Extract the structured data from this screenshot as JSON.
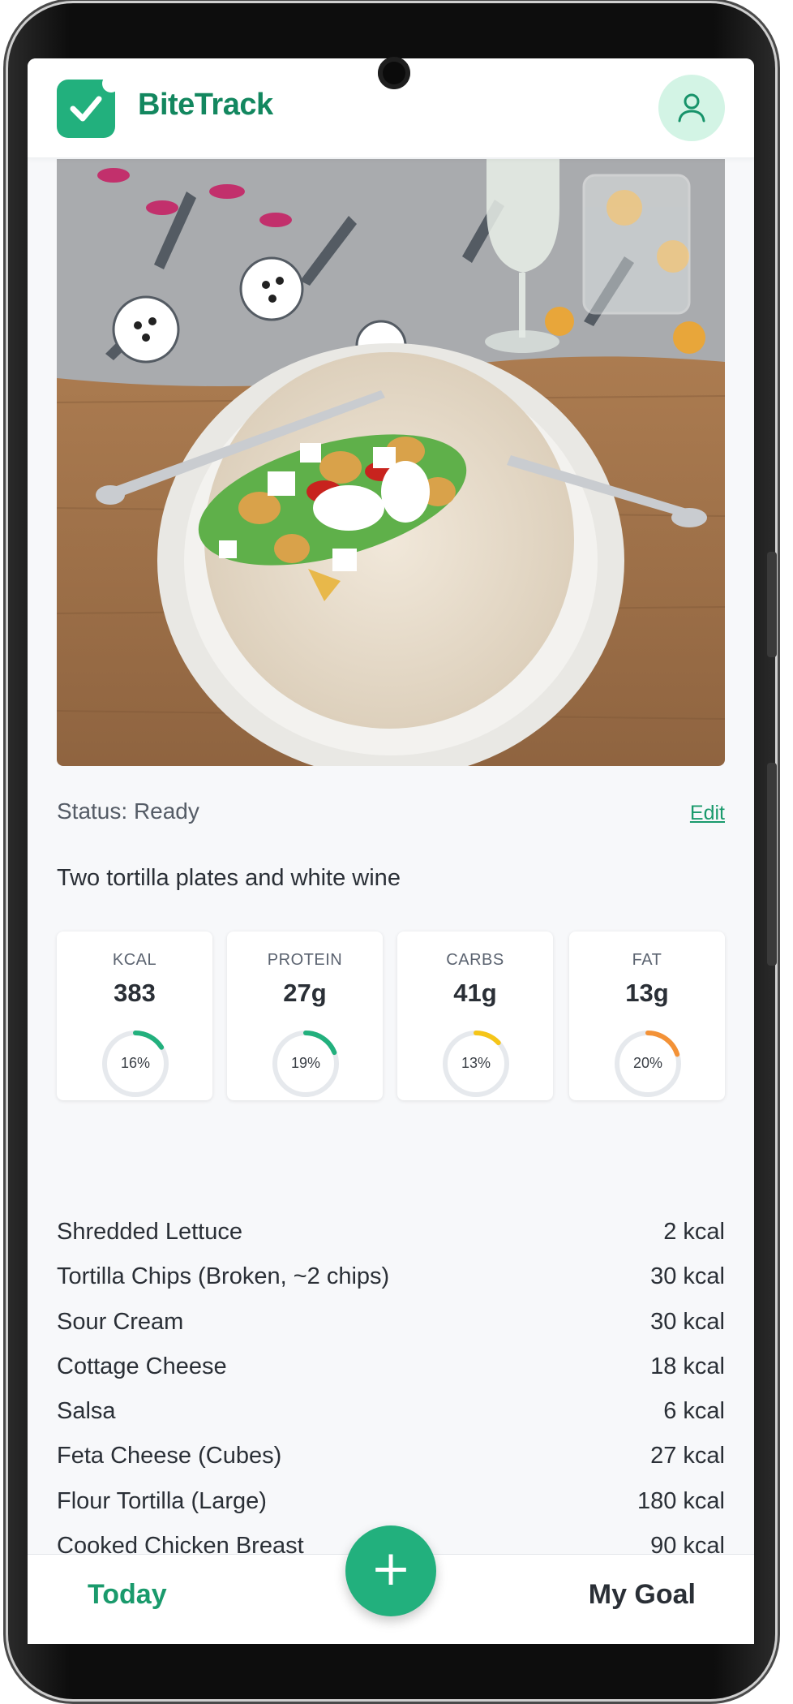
{
  "app": {
    "name": "BiteTrack",
    "brand_color": "#13875f",
    "accent_color": "#22b07d"
  },
  "header": {
    "logo_icon": "check-badge-icon",
    "profile_icon": "user-icon"
  },
  "meal": {
    "photo_icon": "meal-photo",
    "status": "Status: Ready",
    "edit_label": "Edit",
    "description": "Two tortilla plates and white wine"
  },
  "nutrition": [
    {
      "label": "KCAL",
      "value": "383",
      "percent_label": "16%",
      "percent": 16,
      "color": "#22b07d"
    },
    {
      "label": "PROTEIN",
      "value": "27g",
      "percent_label": "19%",
      "percent": 19,
      "color": "#22b07d"
    },
    {
      "label": "CARBS",
      "value": "41g",
      "percent_label": "13%",
      "percent": 13,
      "color": "#f5c518"
    },
    {
      "label": "FAT",
      "value": "13g",
      "percent_label": "20%",
      "percent": 20,
      "color": "#f39237"
    }
  ],
  "items": [
    {
      "name": "Shredded Lettuce",
      "kcal": "2 kcal"
    },
    {
      "name": "Tortilla Chips (Broken, ~2 chips)",
      "kcal": "30 kcal"
    },
    {
      "name": "Sour Cream",
      "kcal": "30 kcal"
    },
    {
      "name": "Cottage Cheese",
      "kcal": "18 kcal"
    },
    {
      "name": "Salsa",
      "kcal": "6 kcal"
    },
    {
      "name": "Feta Cheese (Cubes)",
      "kcal": "27 kcal"
    },
    {
      "name": "Flour Tortilla (Large)",
      "kcal": "180 kcal"
    },
    {
      "name": "Cooked Chicken Breast",
      "kcal": "90 kcal"
    }
  ],
  "nav": {
    "today_label": "Today",
    "goal_label": "My Goal",
    "add_label": "+"
  }
}
